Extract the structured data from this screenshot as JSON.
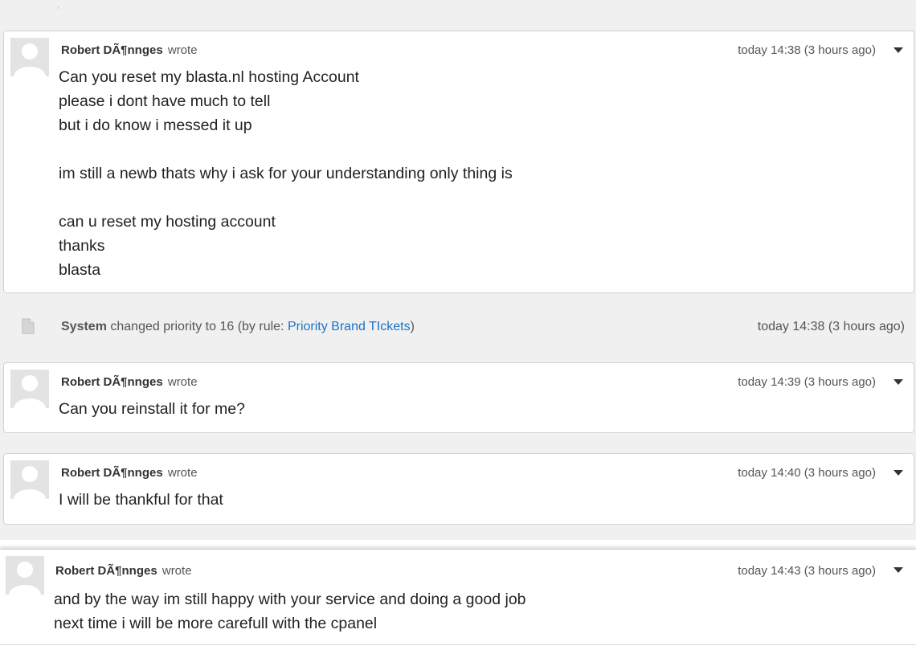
{
  "messages": [
    {
      "author": "Robert DÃ¶nnges",
      "verb": "wrote",
      "time": "today 14:38 (3 hours ago)",
      "lines": [
        "Can you reset my blasta.nl hosting Account",
        "please i dont have much to tell",
        "but i do know i messed it up",
        "",
        "im still a newb thats why i ask for your understanding only thing is",
        "",
        "can u reset my hosting account",
        "thanks",
        "blasta"
      ]
    },
    {
      "author": "Robert DÃ¶nnges",
      "verb": "wrote",
      "time": "today 14:39 (3 hours ago)",
      "lines": [
        "Can you reinstall it for me?"
      ]
    },
    {
      "author": "Robert DÃ¶nnges",
      "verb": "wrote",
      "time": "today 14:40 (3 hours ago)",
      "lines": [
        "I will be thankful for that"
      ]
    },
    {
      "author": "Robert DÃ¶nnges",
      "verb": "wrote",
      "time": "today 14:43 (3 hours ago)",
      "lines": [
        "and by the way im still happy with your service and doing a good job",
        "next time i will be more carefull with the cpanel"
      ]
    }
  ],
  "system_event": {
    "actor": "System",
    "text_before": "changed priority to 16 (by rule: ",
    "rule_link": "Priority Brand TIckets",
    "text_after": ")",
    "time": "today 14:38 (3 hours ago)",
    "icon": "document-icon"
  },
  "icons": {
    "avatar": "default-user-avatar-icon",
    "menu": "caret-down-icon"
  },
  "colors": {
    "link": "#1a73c6",
    "thread_background": "#f0f0f0",
    "card_background": "#ffffff",
    "card_border": "#d2d2d2"
  }
}
